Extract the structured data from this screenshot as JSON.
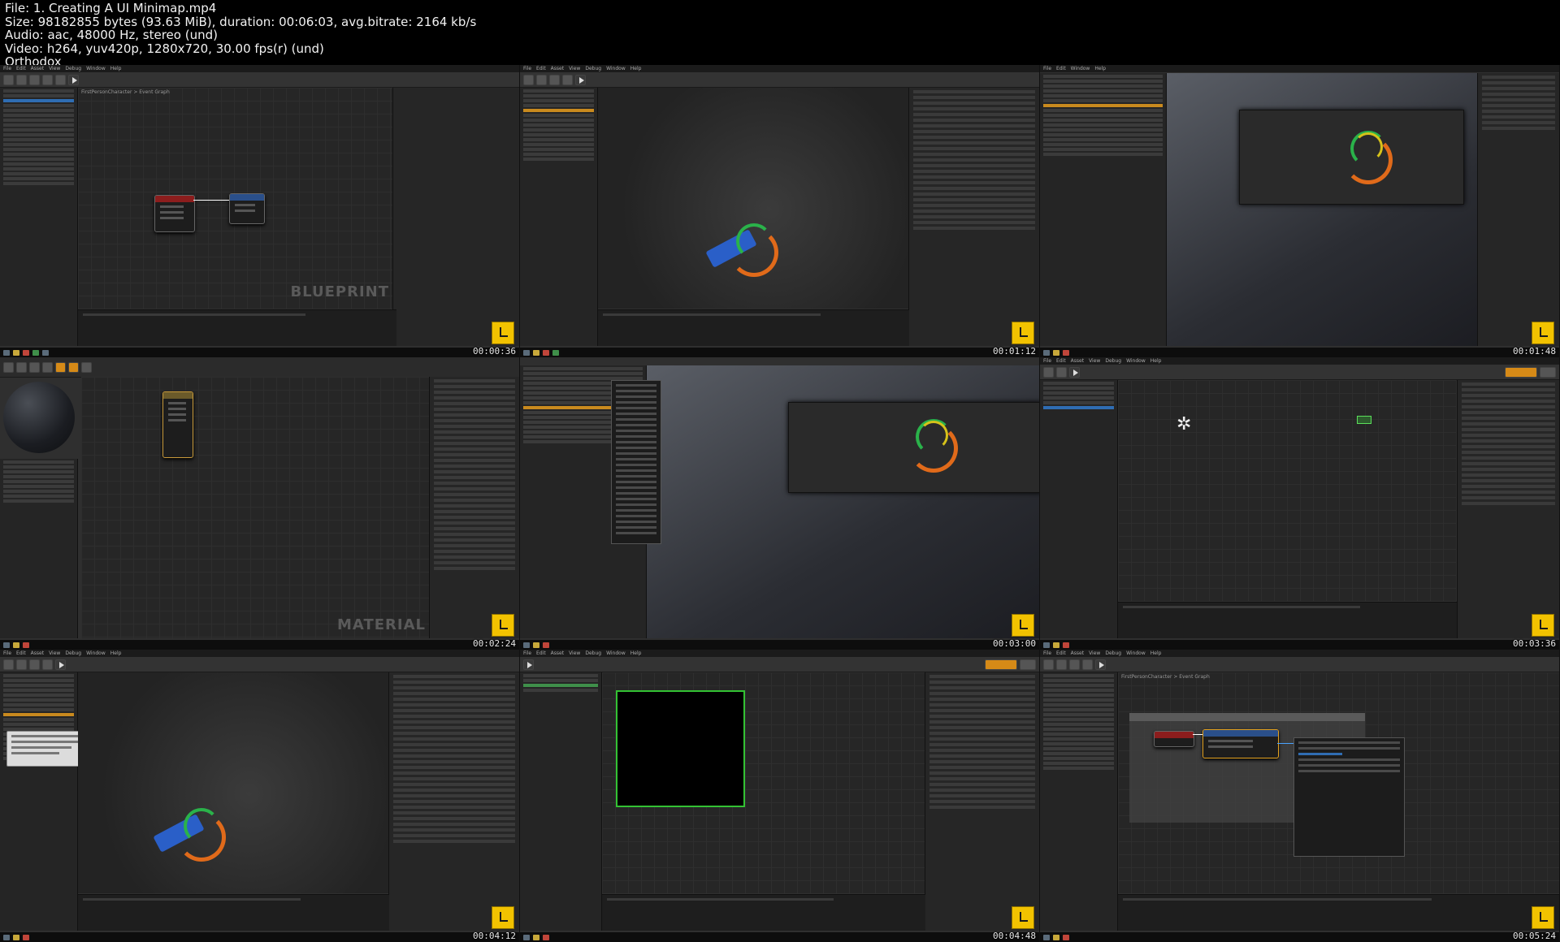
{
  "header": {
    "file": "File: 1. Creating A UI Minimap.mp4",
    "size": "Size: 98182855 bytes (93.63 MiB), duration: 00:06:03, avg.bitrate: 2164 kb/s",
    "audio": "Audio: aac, 48000 Hz, stereo (und)",
    "video": "Video: h264, yuv420p, 1280x720, 30.00 fps(r) (und)",
    "tag": "Orthodox"
  },
  "tiles": [
    {
      "timestamp": "00:00:36",
      "watermark": "BLUEPRINT",
      "breadcrumb": "FirstPersonCharacter > Event Graph"
    },
    {
      "timestamp": "00:01:12"
    },
    {
      "timestamp": "00:01:48"
    },
    {
      "timestamp": "00:02:24",
      "watermark": "MATERIAL"
    },
    {
      "timestamp": "00:03:00"
    },
    {
      "timestamp": "00:03:36"
    },
    {
      "timestamp": "00:04:12"
    },
    {
      "timestamp": "00:04:48"
    },
    {
      "timestamp": "00:05:24",
      "breadcrumb": "FirstPersonCharacter > Event Graph"
    }
  ],
  "menu": [
    "File",
    "Edit",
    "Asset",
    "View",
    "Debug",
    "Window",
    "Help"
  ],
  "colors": {
    "badge": "#f2c200",
    "selection": "#2f6db3",
    "canvas_border": "#33c233",
    "gun": "#2a5fc8",
    "arc_orange": "#e06a1a",
    "arc_green": "#2ab24a"
  }
}
